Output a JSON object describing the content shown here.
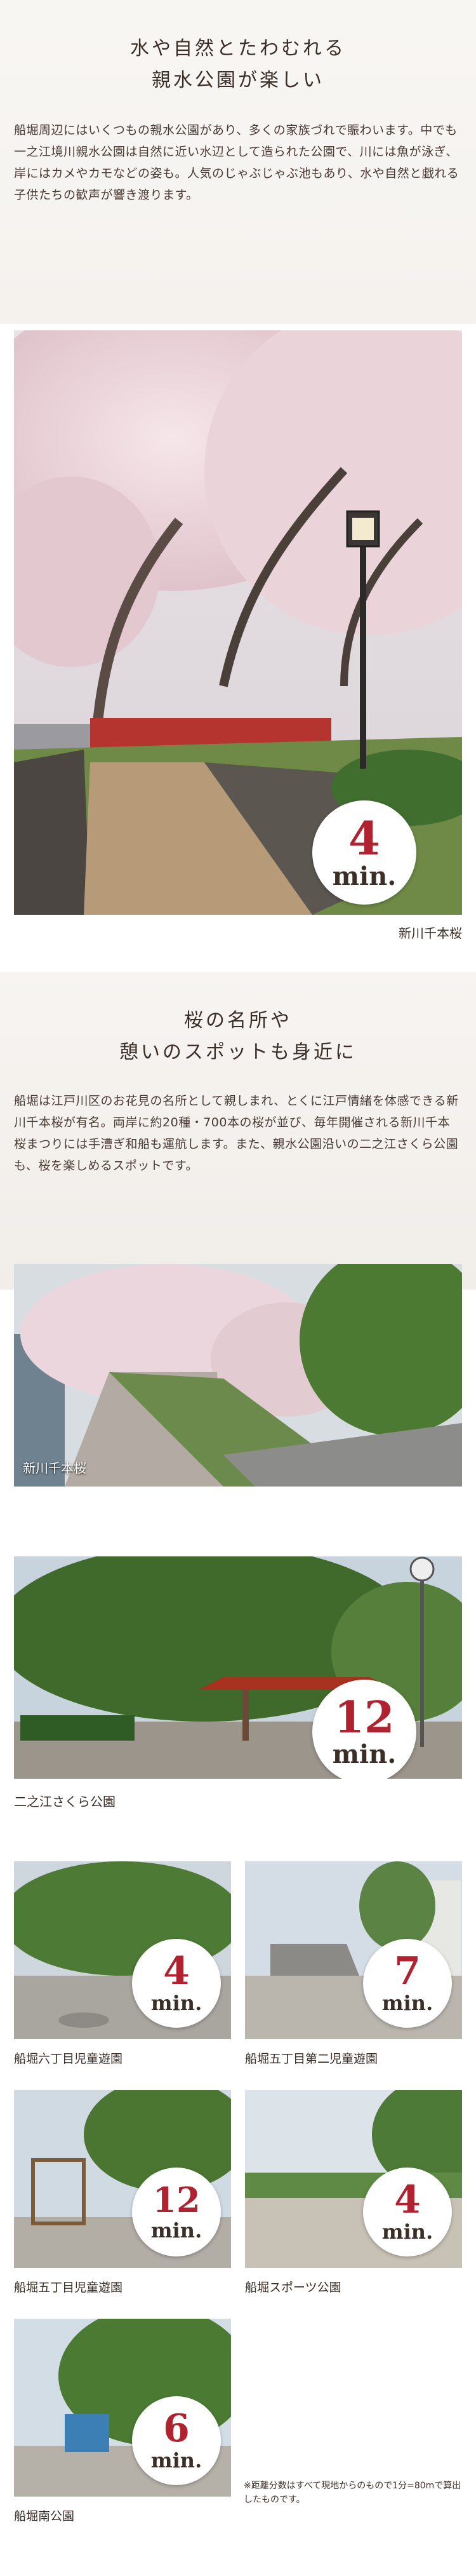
{
  "intro": {
    "headline_line1": "水や自然とたわむれる",
    "headline_line2": "親水公園が楽しい",
    "body": "船堀周辺にはいくつもの親水公園があり、多くの家族づれで賑わいます。中でも一之江境川親水公園は自然に近い水辺として造られた公園で、川には魚が泳ぎ、岸にはカメやカモなどの姿も。人気のじゃぶじゃぶ池もあり、水や自然と戯れる子供たちの歓声が響き渡ります。"
  },
  "photo_main": {
    "minutes": "4",
    "unit": "min.",
    "caption": "新川千本桜"
  },
  "sakura": {
    "headline_line1": "桜の名所や",
    "headline_line2": "憩いのスポットも身近に",
    "body": "船堀は江戸川区のお花見の名所として親しまれ、とくに江戸情緒を体感できる新川千本桜が有名。両岸に約20種・700本の桜が並び、毎年開催される新川千本桜まつりには手漕ぎ和船も運航します。また、親水公園沿いの二之江さくら公園も、桜を楽しめるスポットです。"
  },
  "photo_river": {
    "overlay_label": "新川千本桜"
  },
  "photo_park": {
    "minutes": "12",
    "unit": "min.",
    "caption": "二之江さくら公園"
  },
  "grid": [
    {
      "minutes": "4",
      "unit": "min.",
      "caption": "船堀六丁目児童遊園"
    },
    {
      "minutes": "7",
      "unit": "min.",
      "caption": "船堀五丁目第二児童遊園"
    },
    {
      "minutes": "12",
      "unit": "min.",
      "caption": "船堀五丁目児童遊園"
    },
    {
      "minutes": "4",
      "unit": "min.",
      "caption": "船堀スポーツ公園"
    },
    {
      "minutes": "6",
      "unit": "min.",
      "caption": "船堀南公園"
    }
  ],
  "note": "※距離分数はすべて現地からのもので1分=80mで算出したものです。",
  "colors": {
    "accent": "#b0222f",
    "text": "#3b2e27",
    "sakura": "#f1dbe0"
  }
}
